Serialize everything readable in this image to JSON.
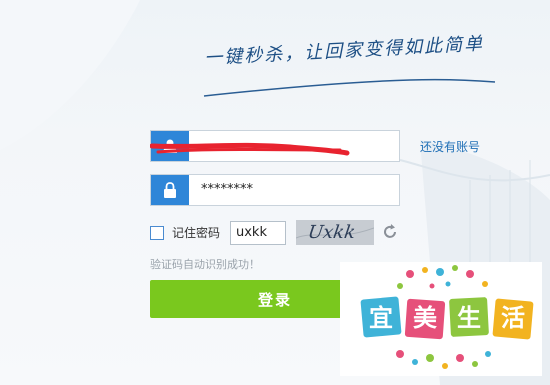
{
  "slogan": "一键秒杀，让回家变得如此简单",
  "login": {
    "username_value": "",
    "password_value": "********",
    "no_account_link": "还没有账号",
    "remember_label": "记住密码",
    "captcha_value": "uxkk",
    "captcha_image_text": "Uxkk",
    "captcha_hint": "验证码自动识别成功！",
    "submit_label": "登录"
  },
  "watermark": {
    "chars": [
      "宜",
      "美",
      "生",
      "活"
    ]
  },
  "colors": {
    "icon_bg": "#2f86d8",
    "link": "#1f6fb6",
    "button": "#7ac81e",
    "redaction": "#e8232f"
  }
}
